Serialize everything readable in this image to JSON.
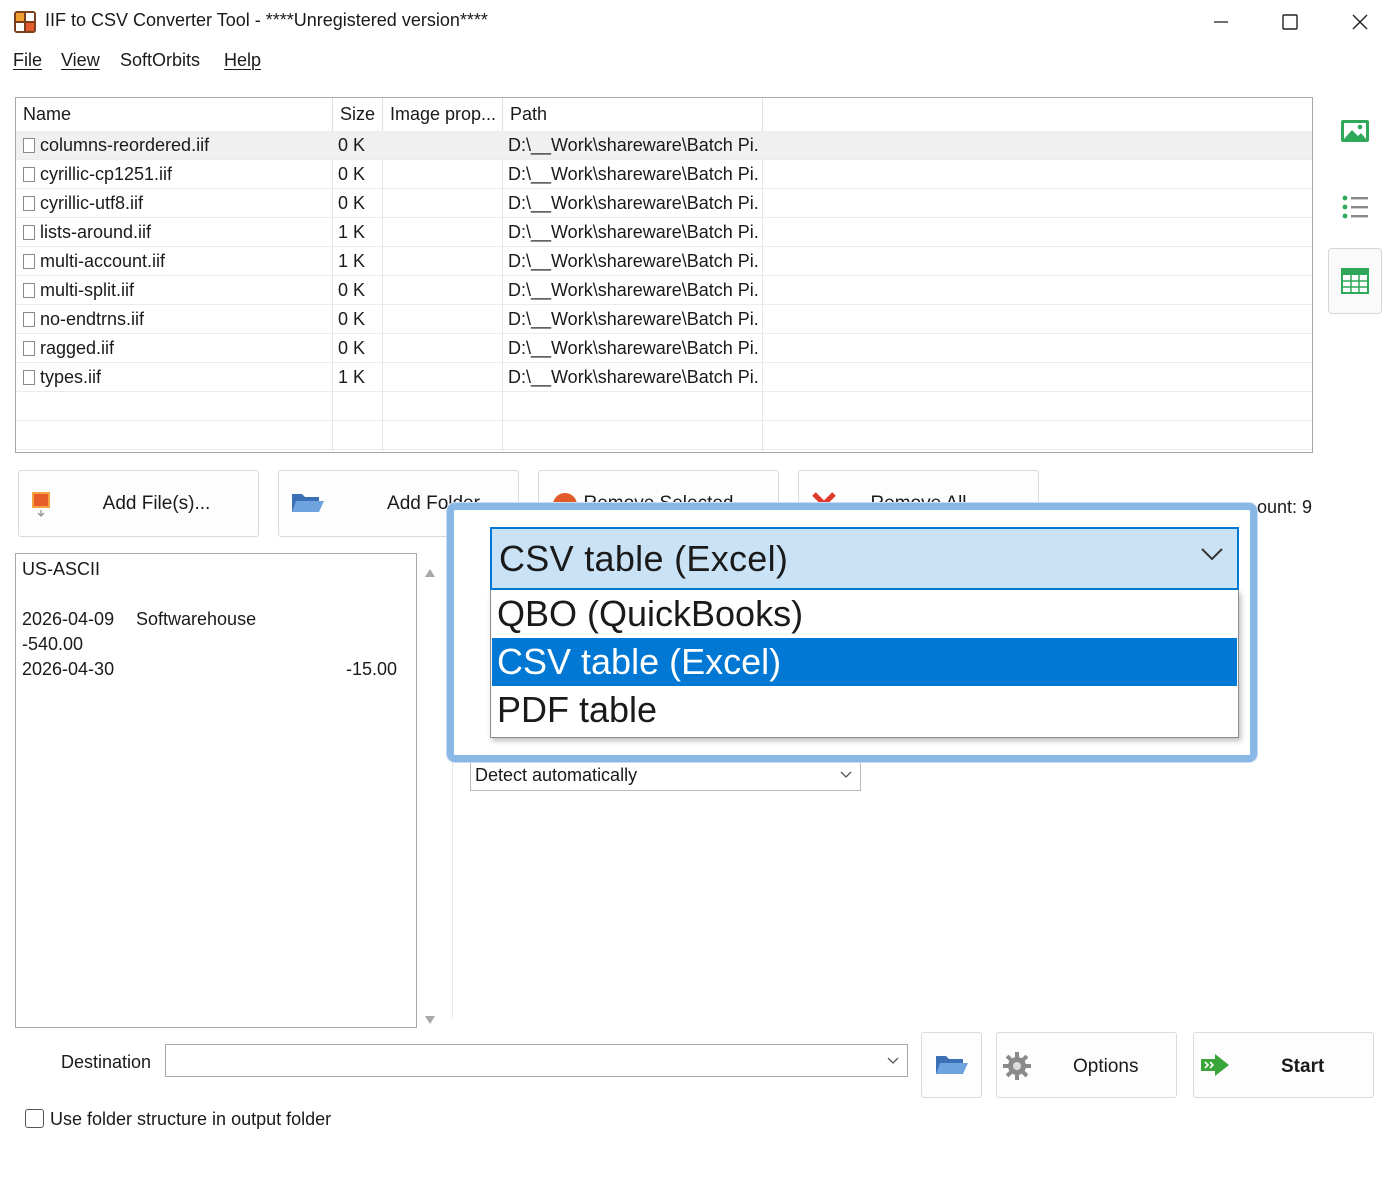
{
  "window": {
    "title": "IIF to CSV Converter Tool - ****Unregistered version****",
    "minimize_icon": "minimize-icon",
    "maximize_icon": "maximize-icon",
    "close_icon": "close-icon"
  },
  "menu": [
    {
      "label": "File",
      "mnemonic": "F"
    },
    {
      "label": "View",
      "mnemonic": "V"
    },
    {
      "label": "SoftOrbits",
      "mnemonic": ""
    },
    {
      "label": "Help",
      "mnemonic": "H"
    }
  ],
  "file_list": {
    "columns": [
      "Name",
      "Size",
      "Image prop...",
      "Path"
    ],
    "rows": [
      {
        "name": "columns-reordered.iif",
        "size": "0 K",
        "image_props": "",
        "path": "D:\\__Work\\shareware\\Batch Pi...",
        "selected": true
      },
      {
        "name": "cyrillic-cp1251.iif",
        "size": "0 K",
        "image_props": "",
        "path": "D:\\__Work\\shareware\\Batch Pi..."
      },
      {
        "name": "cyrillic-utf8.iif",
        "size": "0 K",
        "image_props": "",
        "path": "D:\\__Work\\shareware\\Batch Pi..."
      },
      {
        "name": "lists-around.iif",
        "size": "1 K",
        "image_props": "",
        "path": "D:\\__Work\\shareware\\Batch Pi..."
      },
      {
        "name": "multi-account.iif",
        "size": "1 K",
        "image_props": "",
        "path": "D:\\__Work\\shareware\\Batch Pi..."
      },
      {
        "name": "multi-split.iif",
        "size": "0 K",
        "image_props": "",
        "path": "D:\\__Work\\shareware\\Batch Pi..."
      },
      {
        "name": "no-endtrns.iif",
        "size": "0 K",
        "image_props": "",
        "path": "D:\\__Work\\shareware\\Batch Pi..."
      },
      {
        "name": "ragged.iif",
        "size": "0 K",
        "image_props": "",
        "path": "D:\\__Work\\shareware\\Batch Pi..."
      },
      {
        "name": "types.iif",
        "size": "1 K",
        "image_props": "",
        "path": "D:\\__Work\\shareware\\Batch Pi..."
      }
    ]
  },
  "side_icons": [
    "image-view-icon",
    "list-view-icon",
    "table-view-icon"
  ],
  "toolbar": {
    "add_files": "Add File(s)...",
    "add_folder": "Add Folder",
    "remove_selected": "Remove Selected",
    "remove_all": "Remove All",
    "file_count": "ount: 9"
  },
  "preview": {
    "encoding": "US-ASCII",
    "line1_date": "2026-04-09",
    "line1_name": "Softwarehouse",
    "line2": "-540.00",
    "line3_date": "2026-04-30",
    "line3_amount": "-15.00"
  },
  "format_dropdown": {
    "selected": "CSV table (Excel)",
    "options": [
      "QBO (QuickBooks)",
      "CSV table (Excel)",
      "PDF table"
    ],
    "highlighted_index": 1
  },
  "detect_dropdown": {
    "value": "Detect automatically"
  },
  "bottom": {
    "destination_label": "Destination",
    "destination_value": "",
    "options_label": "Options",
    "start_label": "Start",
    "use_folder_label": "Use folder structure in output folder",
    "use_folder_checked": false
  },
  "colors": {
    "accent": "#0078d4",
    "combo_bg": "#c9e2f5",
    "callout_border": "#8ab8e6",
    "start_arrow": "#3aa53a"
  }
}
